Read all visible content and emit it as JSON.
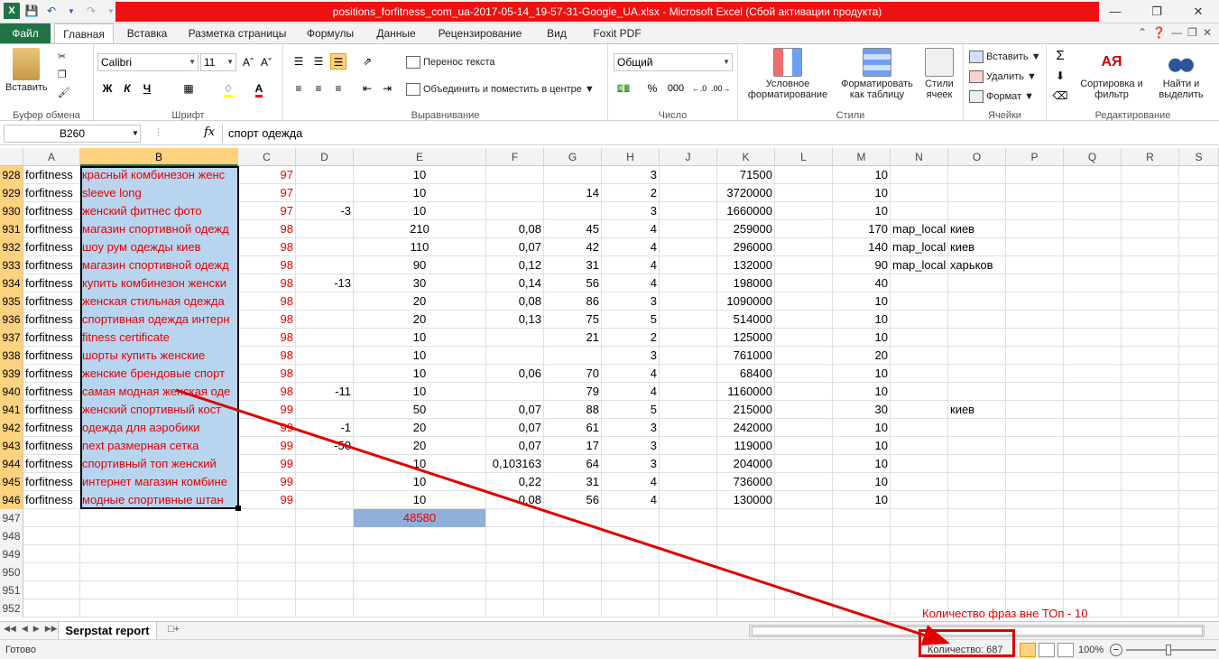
{
  "window": {
    "title": "positions_forfitness_com_ua-2017-05-14_19-57-31-Google_UA.xlsx  -  Microsoft Excel (Сбой активации продукта)"
  },
  "tabs": [
    "Файл",
    "Главная",
    "Вставка",
    "Разметка страницы",
    "Формулы",
    "Данные",
    "Рецензирование",
    "Вид",
    "Foxit PDF"
  ],
  "ribbon": {
    "clipboard": {
      "label": "Буфер обмена",
      "paste": "Вставить"
    },
    "font": {
      "label": "Шрифт",
      "name": "Calibri",
      "size": "11",
      "bold": "Ж",
      "italic": "К",
      "underline": "Ч"
    },
    "alignment": {
      "label": "Выравнивание",
      "wrap": "Перенос текста",
      "merge": "Объединить и поместить в центре"
    },
    "number": {
      "label": "Число",
      "format": "Общий",
      "percent": "%",
      "thousands": "000"
    },
    "styles": {
      "label": "Стили",
      "conditional": "Условное форматирование",
      "table": "Форматировать как таблицу",
      "cell_styles": "Стили ячеек"
    },
    "cells": {
      "label": "Ячейки",
      "insert": "Вставить",
      "delete": "Удалить",
      "format": "Формат"
    },
    "editing": {
      "label": "Редактирование",
      "sort": "Сортировка и фильтр",
      "find": "Найти и выделить"
    }
  },
  "formula_bar": {
    "name_box": "B260",
    "fx": "fx",
    "value": "спорт одежда"
  },
  "columns": [
    "A",
    "B",
    "C",
    "D",
    "E",
    "F",
    "G",
    "H",
    "J",
    "K",
    "L",
    "M",
    "N",
    "O",
    "P",
    "Q",
    "R",
    "S"
  ],
  "rows": [
    {
      "n": "928",
      "A": "forfitness",
      "B": "красный комбинезон женс",
      "C": "97",
      "D": "",
      "E": "10",
      "F": "",
      "G": "",
      "H": "3",
      "K": "71500",
      "M": "10",
      "N": "",
      "O": ""
    },
    {
      "n": "929",
      "A": "forfitness",
      "B": "sleeve long",
      "C": "97",
      "D": "",
      "E": "10",
      "F": "",
      "G": "14",
      "H": "2",
      "K": "3720000",
      "M": "10",
      "N": "",
      "O": ""
    },
    {
      "n": "930",
      "A": "forfitness",
      "B": "женский фитнес фото",
      "C": "97",
      "D": "-3",
      "E": "10",
      "F": "",
      "G": "",
      "H": "3",
      "K": "1660000",
      "M": "10",
      "N": "",
      "O": ""
    },
    {
      "n": "931",
      "A": "forfitness",
      "B": "магазин спортивной одежд",
      "C": "98",
      "D": "",
      "E": "210",
      "F": "0,08",
      "G": "45",
      "H": "4",
      "K": "259000",
      "M": "170",
      "N": "map_local",
      "O": "киев"
    },
    {
      "n": "932",
      "A": "forfitness",
      "B": "шоу рум одежды киев",
      "C": "98",
      "D": "",
      "E": "110",
      "F": "0,07",
      "G": "42",
      "H": "4",
      "K": "296000",
      "M": "140",
      "N": "map_local",
      "O": "киев"
    },
    {
      "n": "933",
      "A": "forfitness",
      "B": "магазин спортивной одежд",
      "C": "98",
      "D": "",
      "E": "90",
      "F": "0,12",
      "G": "31",
      "H": "4",
      "K": "132000",
      "M": "90",
      "N": "map_local",
      "O": "харьков"
    },
    {
      "n": "934",
      "A": "forfitness",
      "B": "купить комбинезон женски",
      "C": "98",
      "D": "-13",
      "E": "30",
      "F": "0,14",
      "G": "56",
      "H": "4",
      "K": "198000",
      "M": "40",
      "N": "",
      "O": ""
    },
    {
      "n": "935",
      "A": "forfitness",
      "B": "женская стильная одежда",
      "C": "98",
      "D": "",
      "E": "20",
      "F": "0,08",
      "G": "86",
      "H": "3",
      "K": "1090000",
      "M": "10",
      "N": "",
      "O": ""
    },
    {
      "n": "936",
      "A": "forfitness",
      "B": "спортивная одежда интерн",
      "C": "98",
      "D": "",
      "E": "20",
      "F": "0,13",
      "G": "75",
      "H": "5",
      "K": "514000",
      "M": "10",
      "N": "",
      "O": ""
    },
    {
      "n": "937",
      "A": "forfitness",
      "B": "fitness certificate",
      "C": "98",
      "D": "",
      "E": "10",
      "F": "",
      "G": "21",
      "H": "2",
      "K": "125000",
      "M": "10",
      "N": "",
      "O": ""
    },
    {
      "n": "938",
      "A": "forfitness",
      "B": "шорты купить женские",
      "C": "98",
      "D": "",
      "E": "10",
      "F": "",
      "G": "",
      "H": "3",
      "K": "761000",
      "M": "20",
      "N": "",
      "O": ""
    },
    {
      "n": "939",
      "A": "forfitness",
      "B": "женские брендовые спорт",
      "C": "98",
      "D": "",
      "E": "10",
      "F": "0,06",
      "G": "70",
      "H": "4",
      "K": "68400",
      "M": "10",
      "N": "",
      "O": ""
    },
    {
      "n": "940",
      "A": "forfitness",
      "B": "самая модная женская оде",
      "C": "98",
      "D": "-11",
      "E": "10",
      "F": "",
      "G": "79",
      "H": "4",
      "K": "1160000",
      "M": "10",
      "N": "",
      "O": ""
    },
    {
      "n": "941",
      "A": "forfitness",
      "B": "женский спортивный кост",
      "C": "99",
      "D": "",
      "E": "50",
      "F": "0,07",
      "G": "88",
      "H": "5",
      "K": "215000",
      "M": "30",
      "N": "",
      "O": "киев"
    },
    {
      "n": "942",
      "A": "forfitness",
      "B": "одежда для аэробики",
      "C": "99",
      "D": "-1",
      "E": "20",
      "F": "0,07",
      "G": "61",
      "H": "3",
      "K": "242000",
      "M": "10",
      "N": "",
      "O": ""
    },
    {
      "n": "943",
      "A": "forfitness",
      "B": "next размерная сетка",
      "C": "99",
      "D": "-50",
      "E": "20",
      "F": "0,07",
      "G": "17",
      "H": "3",
      "K": "119000",
      "M": "10",
      "N": "",
      "O": ""
    },
    {
      "n": "944",
      "A": "forfitness",
      "B": "спортивный топ женский",
      "C": "99",
      "D": "",
      "E": "10",
      "F": "0,103163",
      "G": "64",
      "H": "3",
      "K": "204000",
      "M": "10",
      "N": "",
      "O": ""
    },
    {
      "n": "945",
      "A": "forfitness",
      "B": "интернет магазин комбине",
      "C": "99",
      "D": "",
      "E": "10",
      "F": "0,22",
      "G": "31",
      "H": "4",
      "K": "736000",
      "M": "10",
      "N": "",
      "O": ""
    },
    {
      "n": "946",
      "A": "forfitness",
      "B": "модные спортивные штан",
      "C": "99",
      "D": "",
      "E": "10",
      "F": "0,08",
      "G": "56",
      "H": "4",
      "K": "130000",
      "M": "10",
      "N": "",
      "O": ""
    }
  ],
  "empty_rows": [
    "947",
    "948",
    "949",
    "950",
    "951",
    "952"
  ],
  "total_cell": "48580",
  "sheet_tab": "Serpstat report",
  "status": {
    "ready": "Готово",
    "count": "Количество: 687",
    "zoom": "100%"
  },
  "annotation": {
    "text": "Количество фраз вне ТОп - 10",
    "color": "#e00000"
  }
}
